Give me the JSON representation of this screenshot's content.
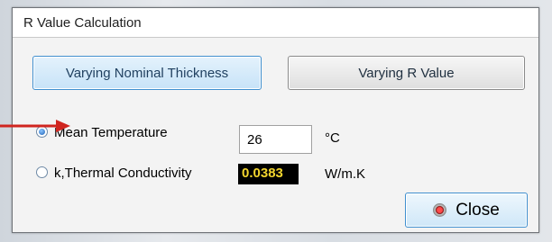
{
  "window": {
    "title": "R Value Calculation"
  },
  "tabs": [
    {
      "label": "Varying Nominal Thickness",
      "active": true
    },
    {
      "label": "Varying R Value",
      "active": false
    }
  ],
  "options": [
    {
      "label": "Mean Temperature",
      "selected": true,
      "value": "26",
      "unit": "°C"
    },
    {
      "label": "k,Thermal Conductivity",
      "selected": false,
      "value": "0.0383",
      "unit": "W/m.K"
    }
  ],
  "close_button": {
    "label": "Close",
    "icon": "close-icon"
  },
  "colors": {
    "annotation_arrow": "#d0251f",
    "k_value_text": "#f3d52e",
    "k_value_bg": "#000000"
  }
}
